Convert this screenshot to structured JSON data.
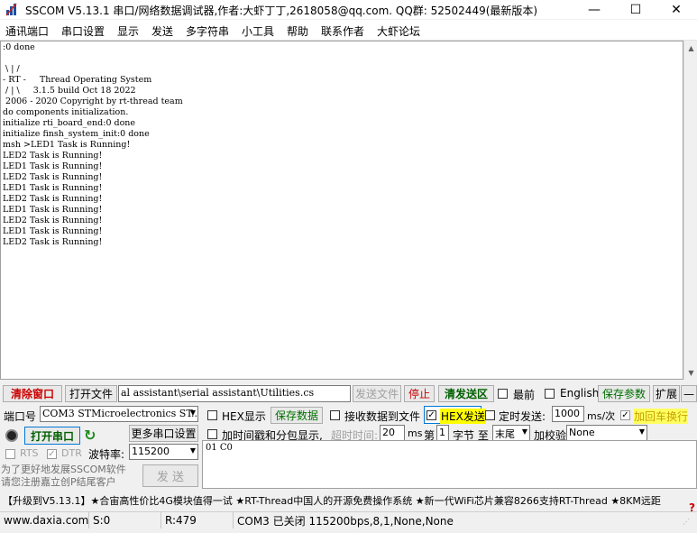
{
  "titlebar": {
    "title": "SSCOM V5.13.1 串口/网络数据调试器,作者:大虾丁丁,2618058@qq.com. QQ群: 52502449(最新版本)",
    "minimize": "—",
    "maximize": "☐",
    "close": "✕"
  },
  "menu": [
    "通讯端口",
    "串口设置",
    "显示",
    "发送",
    "多字符串",
    "小工具",
    "帮助",
    "联系作者",
    "大虾论坛"
  ],
  "receive_text": ":0 done\n\n \\ | /\n- RT -     Thread Operating System\n / | \\     3.1.5 build Oct 18 2022\n 2006 - 2020 Copyright by rt-thread team\ndo components initialization.\ninitialize rti_board_end:0 done\ninitialize finsh_system_init:0 done\nmsh >LED1 Task is Running!\nLED2 Task is Running!\nLED1 Task is Running!\nLED2 Task is Running!\nLED1 Task is Running!\nLED2 Task is Running!\nLED1 Task is Running!\nLED2 Task is Running!\nLED1 Task is Running!\nLED2 Task is Running!",
  "toolbar": {
    "clear_window": "清除窗口",
    "open_file": "打开文件",
    "file_path": "al assistant\\serial assistant\\Utilities.cs",
    "send_file": "发送文件",
    "stop": "停止",
    "clear_send": "清发送区",
    "topmost": "最前",
    "english": "English",
    "save_params": "保存参数",
    "expand": "扩展",
    "collapse": "—"
  },
  "port": {
    "port_label": "端口号",
    "port_value": "COM3 STMicroelectronics ST...",
    "more_settings": "更多串口设置",
    "open_port": "打开串口",
    "baud_label": "波特率:",
    "baud_value": "115200",
    "rts": "RTS",
    "dtr": "DTR"
  },
  "options": {
    "hex_display": "HEX显示",
    "save_data": "保存数据",
    "recv_to_file": "接收数据到文件",
    "hex_send": "HEX发送",
    "timed_send": "定时发送:",
    "interval": "1000",
    "interval_unit": "ms/次",
    "add_crlf": "加回车换行",
    "add_timestamp": "加时间戳和分包显示,",
    "timeout_label": "超时时间:",
    "timeout": "20",
    "timeout_unit": "ms",
    "nth": "第",
    "byte_num": "1",
    "byte_label": "字节 至",
    "byte_end": "末尾",
    "checksum_label": "加校验",
    "checksum_value": "None"
  },
  "send": {
    "text": "01 C0",
    "send_button": "发 送",
    "promo": "为了更好地发展SSCOM软件\n请您注册嘉立创P结尾客户"
  },
  "ad_text": "【升级到V5.13.1】★合宙高性价比4G模块值得一试 ★RT-Thread中国人的开源免费操作系统 ★新一代WiFi芯片兼容8266支持RT-Thread ★8KM远距",
  "status": {
    "site": "www.daxia.com",
    "sent": "S:0",
    "received": "R:479",
    "port_state": "COM3 已关闭  115200bps,8,1,None,None"
  },
  "colors": {
    "clear_window": "#cc0000",
    "stop": "#cc0000",
    "clear_send": "#006000",
    "save_params": "#007000",
    "hex_send_bg": "#ffff00",
    "add_crlf": "#c8a000",
    "open_port": "#006000"
  }
}
